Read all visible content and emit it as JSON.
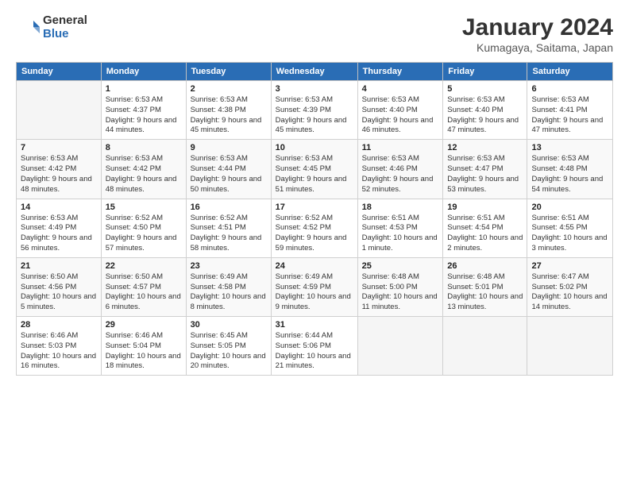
{
  "header": {
    "logo_general": "General",
    "logo_blue": "Blue",
    "month_title": "January 2024",
    "location": "Kumagaya, Saitama, Japan"
  },
  "days_of_week": [
    "Sunday",
    "Monday",
    "Tuesday",
    "Wednesday",
    "Thursday",
    "Friday",
    "Saturday"
  ],
  "weeks": [
    [
      {
        "day": "",
        "sunrise": "",
        "sunset": "",
        "daylight": "",
        "empty": true
      },
      {
        "day": "1",
        "sunrise": "Sunrise: 6:53 AM",
        "sunset": "Sunset: 4:37 PM",
        "daylight": "Daylight: 9 hours and 44 minutes."
      },
      {
        "day": "2",
        "sunrise": "Sunrise: 6:53 AM",
        "sunset": "Sunset: 4:38 PM",
        "daylight": "Daylight: 9 hours and 45 minutes."
      },
      {
        "day": "3",
        "sunrise": "Sunrise: 6:53 AM",
        "sunset": "Sunset: 4:39 PM",
        "daylight": "Daylight: 9 hours and 45 minutes."
      },
      {
        "day": "4",
        "sunrise": "Sunrise: 6:53 AM",
        "sunset": "Sunset: 4:40 PM",
        "daylight": "Daylight: 9 hours and 46 minutes."
      },
      {
        "day": "5",
        "sunrise": "Sunrise: 6:53 AM",
        "sunset": "Sunset: 4:40 PM",
        "daylight": "Daylight: 9 hours and 47 minutes."
      },
      {
        "day": "6",
        "sunrise": "Sunrise: 6:53 AM",
        "sunset": "Sunset: 4:41 PM",
        "daylight": "Daylight: 9 hours and 47 minutes."
      }
    ],
    [
      {
        "day": "7",
        "sunrise": "Sunrise: 6:53 AM",
        "sunset": "Sunset: 4:42 PM",
        "daylight": "Daylight: 9 hours and 48 minutes."
      },
      {
        "day": "8",
        "sunrise": "Sunrise: 6:53 AM",
        "sunset": "Sunset: 4:42 PM",
        "daylight": "Daylight: 9 hours and 48 minutes."
      },
      {
        "day": "9",
        "sunrise": "Sunrise: 6:53 AM",
        "sunset": "Sunset: 4:44 PM",
        "daylight": "Daylight: 9 hours and 50 minutes."
      },
      {
        "day": "10",
        "sunrise": "Sunrise: 6:53 AM",
        "sunset": "Sunset: 4:45 PM",
        "daylight": "Daylight: 9 hours and 51 minutes."
      },
      {
        "day": "11",
        "sunrise": "Sunrise: 6:53 AM",
        "sunset": "Sunset: 4:46 PM",
        "daylight": "Daylight: 9 hours and 52 minutes."
      },
      {
        "day": "12",
        "sunrise": "Sunrise: 6:53 AM",
        "sunset": "Sunset: 4:47 PM",
        "daylight": "Daylight: 9 hours and 53 minutes."
      },
      {
        "day": "13",
        "sunrise": "Sunrise: 6:53 AM",
        "sunset": "Sunset: 4:48 PM",
        "daylight": "Daylight: 9 hours and 54 minutes."
      }
    ],
    [
      {
        "day": "14",
        "sunrise": "Sunrise: 6:53 AM",
        "sunset": "Sunset: 4:49 PM",
        "daylight": "Daylight: 9 hours and 56 minutes."
      },
      {
        "day": "15",
        "sunrise": "Sunrise: 6:52 AM",
        "sunset": "Sunset: 4:50 PM",
        "daylight": "Daylight: 9 hours and 57 minutes."
      },
      {
        "day": "16",
        "sunrise": "Sunrise: 6:52 AM",
        "sunset": "Sunset: 4:51 PM",
        "daylight": "Daylight: 9 hours and 58 minutes."
      },
      {
        "day": "17",
        "sunrise": "Sunrise: 6:52 AM",
        "sunset": "Sunset: 4:52 PM",
        "daylight": "Daylight: 9 hours and 59 minutes."
      },
      {
        "day": "18",
        "sunrise": "Sunrise: 6:51 AM",
        "sunset": "Sunset: 4:53 PM",
        "daylight": "Daylight: 10 hours and 1 minute."
      },
      {
        "day": "19",
        "sunrise": "Sunrise: 6:51 AM",
        "sunset": "Sunset: 4:54 PM",
        "daylight": "Daylight: 10 hours and 2 minutes."
      },
      {
        "day": "20",
        "sunrise": "Sunrise: 6:51 AM",
        "sunset": "Sunset: 4:55 PM",
        "daylight": "Daylight: 10 hours and 3 minutes."
      }
    ],
    [
      {
        "day": "21",
        "sunrise": "Sunrise: 6:50 AM",
        "sunset": "Sunset: 4:56 PM",
        "daylight": "Daylight: 10 hours and 5 minutes."
      },
      {
        "day": "22",
        "sunrise": "Sunrise: 6:50 AM",
        "sunset": "Sunset: 4:57 PM",
        "daylight": "Daylight: 10 hours and 6 minutes."
      },
      {
        "day": "23",
        "sunrise": "Sunrise: 6:49 AM",
        "sunset": "Sunset: 4:58 PM",
        "daylight": "Daylight: 10 hours and 8 minutes."
      },
      {
        "day": "24",
        "sunrise": "Sunrise: 6:49 AM",
        "sunset": "Sunset: 4:59 PM",
        "daylight": "Daylight: 10 hours and 9 minutes."
      },
      {
        "day": "25",
        "sunrise": "Sunrise: 6:48 AM",
        "sunset": "Sunset: 5:00 PM",
        "daylight": "Daylight: 10 hours and 11 minutes."
      },
      {
        "day": "26",
        "sunrise": "Sunrise: 6:48 AM",
        "sunset": "Sunset: 5:01 PM",
        "daylight": "Daylight: 10 hours and 13 minutes."
      },
      {
        "day": "27",
        "sunrise": "Sunrise: 6:47 AM",
        "sunset": "Sunset: 5:02 PM",
        "daylight": "Daylight: 10 hours and 14 minutes."
      }
    ],
    [
      {
        "day": "28",
        "sunrise": "Sunrise: 6:46 AM",
        "sunset": "Sunset: 5:03 PM",
        "daylight": "Daylight: 10 hours and 16 minutes."
      },
      {
        "day": "29",
        "sunrise": "Sunrise: 6:46 AM",
        "sunset": "Sunset: 5:04 PM",
        "daylight": "Daylight: 10 hours and 18 minutes."
      },
      {
        "day": "30",
        "sunrise": "Sunrise: 6:45 AM",
        "sunset": "Sunset: 5:05 PM",
        "daylight": "Daylight: 10 hours and 20 minutes."
      },
      {
        "day": "31",
        "sunrise": "Sunrise: 6:44 AM",
        "sunset": "Sunset: 5:06 PM",
        "daylight": "Daylight: 10 hours and 21 minutes."
      },
      {
        "day": "",
        "sunrise": "",
        "sunset": "",
        "daylight": "",
        "empty": true
      },
      {
        "day": "",
        "sunrise": "",
        "sunset": "",
        "daylight": "",
        "empty": true
      },
      {
        "day": "",
        "sunrise": "",
        "sunset": "",
        "daylight": "",
        "empty": true
      }
    ]
  ]
}
